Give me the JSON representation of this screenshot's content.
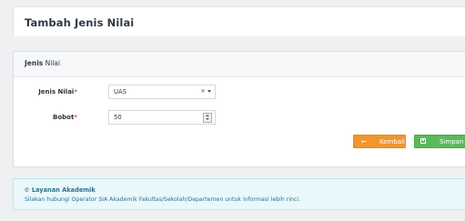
{
  "page": {
    "title": "Tambah Jenis Nilai"
  },
  "panel": {
    "heading_bold": "Jenis",
    "heading_rest": " Nilai"
  },
  "form": {
    "jenis_nilai": {
      "label": "Jenis Nilai",
      "required_mark": "*",
      "value": "UAS",
      "clear_glyph": "×"
    },
    "bobot": {
      "label": "Bobot",
      "required_mark": "*",
      "value": "50"
    }
  },
  "buttons": {
    "kembali": {
      "icon": "←",
      "label": "Kembali"
    },
    "simpan": {
      "icon": "floppy-disk-icon",
      "label": "Simpan"
    }
  },
  "alert": {
    "icon": "✆",
    "title": "Layanan Akademik",
    "text": "Silakan hubungi Operator SIA Akademik Fakultas/Sekolah/Departemen untuk informasi lebih rinci."
  },
  "colors": {
    "orange_button": "#f0962e",
    "green_button": "#5cb85c",
    "required": "#d9534f",
    "alert_text": "#31708f",
    "alert_bg": "#e9f8fb"
  }
}
